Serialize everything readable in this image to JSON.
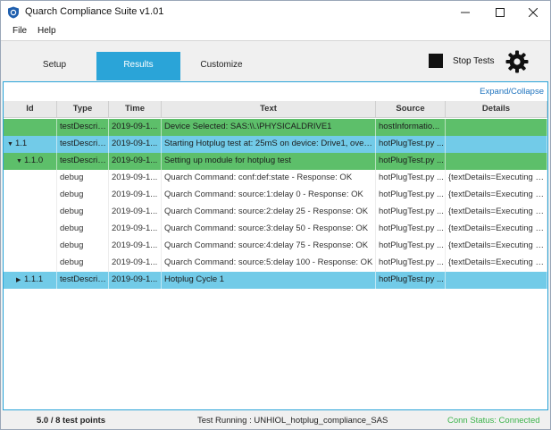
{
  "window": {
    "title": "Quarch Compliance Suite v1.01"
  },
  "menu": {
    "file": "File",
    "help": "Help"
  },
  "tabs": {
    "setup": "Setup",
    "results": "Results",
    "customize": "Customize",
    "active": "Results"
  },
  "toolbar": {
    "stop_tests": "Stop Tests"
  },
  "results": {
    "expand_collapse": "Expand/Collapse",
    "columns": {
      "id": "Id",
      "type": "Type",
      "time": "Time",
      "text": "Text",
      "source": "Source",
      "details": "Details"
    },
    "rows": [
      {
        "color": "green",
        "expander": "",
        "id": "",
        "type": "testDescription",
        "time": "2019-09-1...",
        "text": "Device Selected: SAS:\\\\.\\PHYSICALDRIVE1",
        "source": "hostInformatio...",
        "details": ""
      },
      {
        "color": "blue",
        "expander": "▼",
        "id": "1.1",
        "type": "testDescription",
        "time": "2019-09-1...",
        "text": "Starting Hotplug test at: 25mS on device: Drive1, over ...",
        "source": "hotPlugTest.py ...",
        "details": ""
      },
      {
        "color": "green",
        "expander": "▼",
        "id": "1.1.0",
        "type": "testDescription",
        "time": "2019-09-1...",
        "text": "Setting up module for hotplug test",
        "source": "hotPlugTest.py ...",
        "details": ""
      },
      {
        "color": "white",
        "expander": "",
        "id": "",
        "type": "debug",
        "time": "2019-09-1...",
        "text": "Quarch Command: conf:def:state - Response: OK",
        "source": "hotPlugTest.py ...",
        "details": "{textDetails=Executing c..."
      },
      {
        "color": "white",
        "expander": "",
        "id": "",
        "type": "debug",
        "time": "2019-09-1...",
        "text": "Quarch Command: source:1:delay 0 - Response: OK",
        "source": "hotPlugTest.py ...",
        "details": "{textDetails=Executing c..."
      },
      {
        "color": "white",
        "expander": "",
        "id": "",
        "type": "debug",
        "time": "2019-09-1...",
        "text": "Quarch Command: source:2:delay 25 - Response: OK",
        "source": "hotPlugTest.py ...",
        "details": "{textDetails=Executing c..."
      },
      {
        "color": "white",
        "expander": "",
        "id": "",
        "type": "debug",
        "time": "2019-09-1...",
        "text": "Quarch Command: source:3:delay 50 - Response: OK",
        "source": "hotPlugTest.py ...",
        "details": "{textDetails=Executing c..."
      },
      {
        "color": "white",
        "expander": "",
        "id": "",
        "type": "debug",
        "time": "2019-09-1...",
        "text": "Quarch Command: source:4:delay 75 - Response: OK",
        "source": "hotPlugTest.py ...",
        "details": "{textDetails=Executing c..."
      },
      {
        "color": "white",
        "expander": "",
        "id": "",
        "type": "debug",
        "time": "2019-09-1...",
        "text": "Quarch Command: source:5:delay 100 - Response: OK",
        "source": "hotPlugTest.py ...",
        "details": "{textDetails=Executing c..."
      },
      {
        "color": "blue",
        "expander": "▶",
        "id": "1.1.1",
        "type": "testDescription",
        "time": "2019-09-1...",
        "text": "Hotplug Cycle 1",
        "source": "hotPlugTest.py ...",
        "details": ""
      }
    ]
  },
  "status": {
    "tests": "5.0 / 8 test points",
    "running": "Test Running : UNHIOL_hotplug_compliance_SAS",
    "conn": "Conn Status: Connected"
  },
  "colors": {
    "accent": "#2aa4d8",
    "row_green": "#5dbf6a",
    "row_blue": "#72cbe8",
    "connected": "#3bb34a",
    "link": "#1e73be"
  },
  "icons": {
    "app": "shield-icon",
    "minimize": "minimize-icon",
    "maximize": "maximize-icon",
    "close": "close-icon",
    "stop": "stop-icon",
    "settings": "gear-icon",
    "expanded": "chevron-down-icon",
    "collapsed": "chevron-right-icon"
  }
}
